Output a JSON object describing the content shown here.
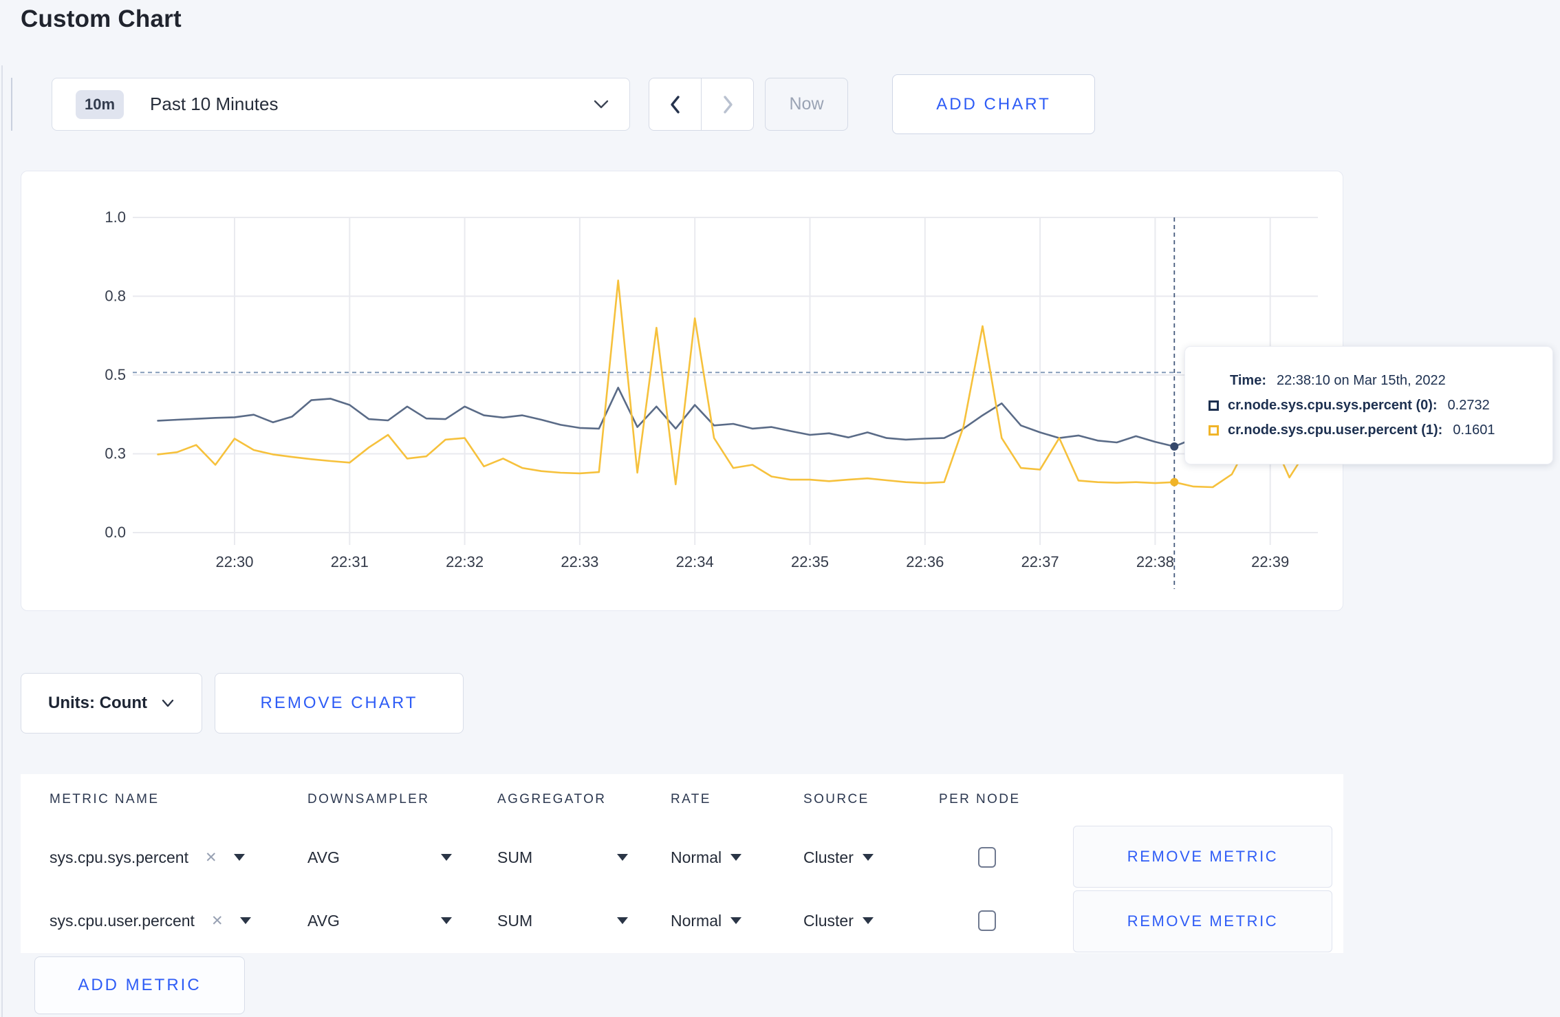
{
  "page": {
    "title": "Custom Chart"
  },
  "toolbar": {
    "time_badge": "10m",
    "time_label": "Past 10 Minutes",
    "now": "Now",
    "add_chart": "ADD CHART"
  },
  "icons": {
    "clear": "✕"
  },
  "chart_data": {
    "type": "line",
    "xlabel": "",
    "ylabel": "",
    "ylim": [
      0,
      1
    ],
    "grid": true,
    "xticks": [
      "22:30",
      "22:31",
      "22:32",
      "22:33",
      "22:34",
      "22:35",
      "22:36",
      "22:37",
      "22:38",
      "22:39"
    ],
    "yticks": [
      {
        "label": "0.0",
        "value": 0
      },
      {
        "label": "0.3",
        "value": 0.25
      },
      {
        "label": "0.5",
        "value": 0.5
      },
      {
        "label": "0.8",
        "value": 0.75
      },
      {
        "label": "1.0",
        "value": 1
      }
    ],
    "sample_interval_seconds": 10,
    "first_sample_time": "22:29:20",
    "first_tick_sample_index": 4,
    "samples_per_tick": 6,
    "guide_value": 0.508,
    "crosshair_index": 53,
    "crosshair_time": "22:38:10",
    "series": [
      {
        "name": "cr.node.sys.cpu.sys.percent (0)",
        "color": "#5a6b87",
        "dot_color": "#35486b",
        "values": [
          0.355,
          0.358,
          0.361,
          0.364,
          0.366,
          0.374,
          0.35,
          0.368,
          0.42,
          0.425,
          0.405,
          0.36,
          0.356,
          0.4,
          0.362,
          0.36,
          0.4,
          0.372,
          0.365,
          0.372,
          0.358,
          0.342,
          0.332,
          0.33,
          0.46,
          0.335,
          0.4,
          0.33,
          0.405,
          0.34,
          0.345,
          0.33,
          0.335,
          0.322,
          0.31,
          0.315,
          0.302,
          0.318,
          0.3,
          0.295,
          0.298,
          0.3,
          0.33,
          0.372,
          0.41,
          0.34,
          0.318,
          0.3,
          0.308,
          0.292,
          0.286,
          0.306,
          0.288,
          0.2732,
          0.298,
          0.294,
          0.29,
          0.296,
          0.31,
          0.296,
          0.305
        ]
      },
      {
        "name": "cr.node.sys.cpu.user.percent (1)",
        "color": "#f6c13c",
        "dot_color": "#f0b429",
        "values": [
          0.248,
          0.255,
          0.278,
          0.215,
          0.298,
          0.262,
          0.248,
          0.24,
          0.233,
          0.227,
          0.222,
          0.27,
          0.31,
          0.235,
          0.242,
          0.295,
          0.3,
          0.21,
          0.235,
          0.205,
          0.195,
          0.19,
          0.188,
          0.192,
          0.8,
          0.19,
          0.65,
          0.153,
          0.68,
          0.3,
          0.205,
          0.215,
          0.178,
          0.168,
          0.168,
          0.163,
          0.168,
          0.172,
          0.166,
          0.16,
          0.157,
          0.16,
          0.335,
          0.655,
          0.3,
          0.205,
          0.2,
          0.3,
          0.165,
          0.16,
          0.158,
          0.16,
          0.157,
          0.1601,
          0.146,
          0.144,
          0.185,
          0.3,
          0.31,
          0.175,
          0.27
        ]
      }
    ]
  },
  "tooltip": {
    "time_label": "Time:",
    "time_value": "22:38:10 on Mar 15th, 2022",
    "entries": [
      {
        "swatch": "#1d3050",
        "name": "cr.node.sys.cpu.sys.percent (0):",
        "value": "0.2732"
      },
      {
        "swatch": "#f0b429",
        "name": "cr.node.sys.cpu.user.percent (1):",
        "value": "0.1601"
      }
    ]
  },
  "controls": {
    "units": "Units: Count",
    "remove_chart": "REMOVE CHART",
    "add_metric": "ADD METRIC"
  },
  "table": {
    "headers": [
      "METRIC NAME",
      "DOWNSAMPLER",
      "AGGREGATOR",
      "RATE",
      "SOURCE",
      "PER NODE"
    ],
    "remove_metric": "REMOVE METRIC",
    "rows": [
      {
        "metric": "sys.cpu.sys.percent",
        "downsampler": "AVG",
        "aggregator": "SUM",
        "rate": "Normal",
        "source": "Cluster",
        "per_node": false
      },
      {
        "metric": "sys.cpu.user.percent",
        "downsampler": "AVG",
        "aggregator": "SUM",
        "rate": "Normal",
        "source": "Cluster",
        "per_node": false
      }
    ]
  }
}
